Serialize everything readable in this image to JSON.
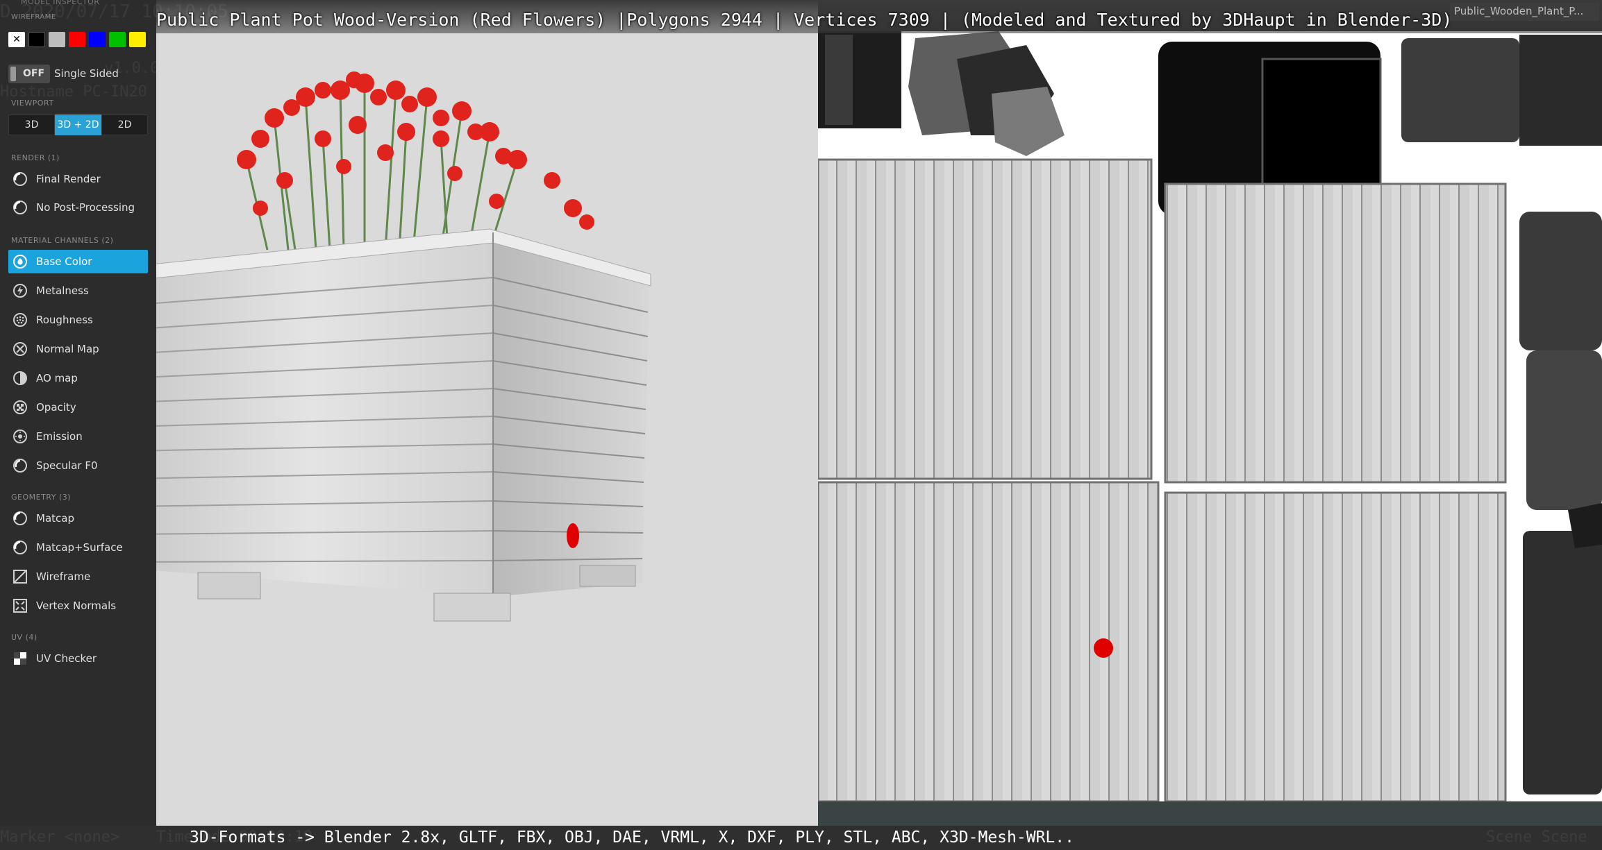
{
  "title": "Public Plant Pot Wood-Version (Red Flowers) |Polygons 2944 | Vertices 7309 | (Modeled and Textured by 3DHaupt in Blender-3D)",
  "file_badge": "Public_Wooden_Plant_P...",
  "formats_line": "3D-Formats -> Blender 2.8x, GLTF, FBX, OBJ, DAE, VRML, X, DXF, PLY, STL, ABC, X3D-Mesh-WRL..",
  "sidebar": {
    "panel_title": "Model Inspector",
    "wireframe_label": "WIREFRAME",
    "wireframe_colors": [
      "#ffffff",
      "#000000",
      "#bdbdbd",
      "#ff0000",
      "#0000ff",
      "#00c000",
      "#ffee00"
    ],
    "single_sided": {
      "toggle": "OFF",
      "label": "Single Sided"
    },
    "viewport": {
      "label": "VIEWPORT",
      "options": [
        "3D",
        "3D + 2D",
        "2D"
      ],
      "selected": "3D + 2D"
    },
    "render": {
      "label": "RENDER (1)",
      "items": [
        "Final Render",
        "No Post-Processing"
      ]
    },
    "material": {
      "label": "MATERIAL CHANNELS (2)",
      "items": [
        "Base Color",
        "Metalness",
        "Roughness",
        "Normal Map",
        "AO map",
        "Opacity",
        "Emission",
        "Specular F0"
      ],
      "selected": "Base Color"
    },
    "geometry": {
      "label": "GEOMETRY (3)",
      "items": [
        "Matcap",
        "Matcap+Surface",
        "Wireframe",
        "Vertex Normals"
      ]
    },
    "uv": {
      "label": "UV (4)",
      "items": [
        "UV Checker"
      ]
    }
  },
  "ghost_text": {
    "date": "D 2020/07/17 10:10:05",
    "version": "v1.0.0",
    "hostname": "Hostname PC-IN20",
    "marker": "Marker <none>",
    "timecode": "Timecode 00:00:19",
    "scene": "Scene Scene"
  },
  "accent_color": "#1aa3dc"
}
